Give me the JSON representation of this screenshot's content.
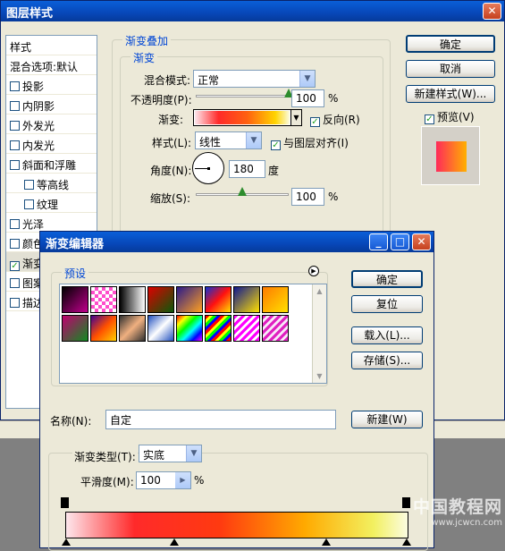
{
  "layer_style": {
    "title": "图层样式",
    "styles_list_header": "样式",
    "blend_options": "混合选项:默认",
    "effects": [
      {
        "label": "投影",
        "checked": false,
        "indent": false
      },
      {
        "label": "内阴影",
        "checked": false,
        "indent": false
      },
      {
        "label": "外发光",
        "checked": false,
        "indent": false
      },
      {
        "label": "内发光",
        "checked": false,
        "indent": false
      },
      {
        "label": "斜面和浮雕",
        "checked": false,
        "indent": false
      },
      {
        "label": "等高线",
        "checked": false,
        "indent": true
      },
      {
        "label": "纹理",
        "checked": false,
        "indent": true
      },
      {
        "label": "光泽",
        "checked": false,
        "indent": false
      },
      {
        "label": "颜色叠加",
        "checked": false,
        "indent": false
      },
      {
        "label": "渐变叠加",
        "checked": true,
        "indent": false
      },
      {
        "label": "图案叠加",
        "checked": false,
        "indent": false
      },
      {
        "label": "描边",
        "checked": false,
        "indent": false
      }
    ],
    "panel": {
      "section": "渐变叠加",
      "subsection": "渐变",
      "blend_mode_label": "混合模式:",
      "blend_mode_value": "正常",
      "opacity_label": "不透明度(P):",
      "opacity_value": "100",
      "opacity_fraction": 1.0,
      "percent": "%",
      "gradient_label": "渐变:",
      "reverse_label": "反向(R)",
      "reverse_checked": true,
      "style_label": "样式(L):",
      "style_value": "线性",
      "align_label": "与图层对齐(I)",
      "align_checked": true,
      "angle_label": "角度(N):",
      "angle_value": "180",
      "degree": "度",
      "scale_label": "缩放(S):",
      "scale_value": "100",
      "scale_fraction": 0.5
    },
    "buttons": {
      "ok": "确定",
      "cancel": "取消",
      "new_style": "新建样式(W)...",
      "preview": "预览(V)",
      "preview_checked": true
    }
  },
  "gradient_editor": {
    "title": "渐变编辑器",
    "presets_label": "预设",
    "ok": "确定",
    "reset": "复位",
    "load": "载入(L)...",
    "save": "存储(S)...",
    "name_label": "名称(N):",
    "name_value": "自定",
    "new_button": "新建(W)",
    "type_label": "渐变类型(T):",
    "type_value": "实底",
    "smooth_label": "平滑度(M):",
    "smooth_value": "100",
    "percent": "%",
    "presets": [
      "linear-gradient(135deg,#000,#c0008c)",
      "repeating-conic-gradient(#ff4ecb 0 25%,#fff 0 50%) 0 0/8px 8px",
      "linear-gradient(90deg,#000,#fff)",
      "linear-gradient(135deg,#d00,#0a5a0a)",
      "linear-gradient(135deg,#2a1a8a,#ffa020)",
      "linear-gradient(135deg,#1030d0,#ff1010,#ffe000)",
      "linear-gradient(135deg,#101890,#ffe000)",
      "linear-gradient(135deg,#ff7b00,#ffe000)",
      "linear-gradient(135deg,#c00070,#108a20)",
      "linear-gradient(135deg,#400090,#ff5000,#ffd000)",
      "linear-gradient(135deg,#303030,#f0b080,#303030)",
      "linear-gradient(135deg,#2050c0,#fff,#2050c0)",
      "linear-gradient(135deg,#f00,#ff0,#0f0,#0ff,#00f,#f0f)",
      "repeating-linear-gradient(135deg,#f00 0 3px,#ff0 3px 6px,#0f0 6px 9px,#00f 9px 12px)",
      "repeating-linear-gradient(135deg,#f0f 0 3px,#fff 3px 6px)",
      "repeating-linear-gradient(135deg,#e020c0 0 3px,#f8e8f8 3px 6px)"
    ],
    "bar_gradient": "linear-gradient(90deg,#fde6ec 0%,#ff2a2a 20%,#ff3a10 45%,#ffaa00 70%,#f2f060 90%,#fbfce0 100%)"
  },
  "watermark": {
    "line1": "中国教程网",
    "line2": "www.jcwcn.com"
  },
  "colors": {
    "titlebar_blue": "#0747b8",
    "dialog_bg": "#ece9d8",
    "accent_text": "#0046d5"
  }
}
